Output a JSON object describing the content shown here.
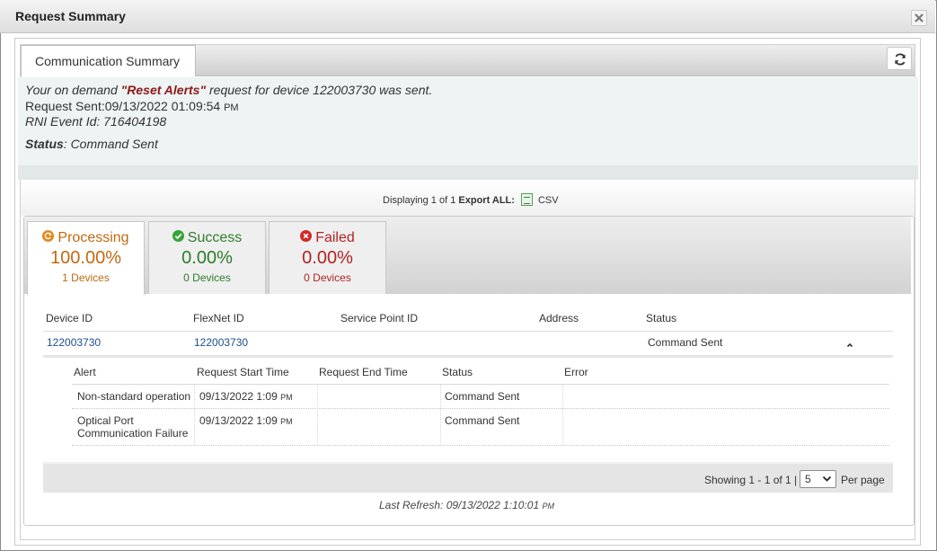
{
  "dialog": {
    "title": "Request Summary"
  },
  "tabs": {
    "main_label": "Communication Summary"
  },
  "info": {
    "line1_prefix": "Your on demand ",
    "alert_name": "\"Reset Alerts\"",
    "line1_suffix": " request for device 122003730 was sent.",
    "request_sent_prefix": "Request Sent:",
    "request_sent_value": "09/13/2022 01:09:54",
    "request_sent_ampm": "PM",
    "rni_event": "RNI Event Id: 716404198",
    "status_label": "Status",
    "status_value": ": Command Sent"
  },
  "export": {
    "displaying": "Displaying 1 of 1",
    "export_all": "Export ALL:",
    "csv": "CSV"
  },
  "stats": [
    {
      "label": "Processing",
      "pct": "100.00%",
      "devices": "1 Devices",
      "color": "#c06a10",
      "icon": "refresh-circle-icon"
    },
    {
      "label": "Success",
      "pct": "0.00%",
      "devices": "0 Devices",
      "color": "#2e7d2e",
      "icon": "check-circle-icon"
    },
    {
      "label": "Failed",
      "pct": "0.00%",
      "devices": "0 Devices",
      "color": "#b32323",
      "icon": "x-circle-icon"
    }
  ],
  "devices_table": {
    "headers": [
      "Device ID",
      "FlexNet ID",
      "Service Point ID",
      "Address",
      "Status"
    ],
    "rows": [
      {
        "device_id": "122003730",
        "flexnet_id": "122003730",
        "service_point_id": "",
        "address": "",
        "status": "Command Sent"
      }
    ]
  },
  "alerts_table": {
    "headers": [
      "Alert",
      "Request Start Time",
      "Request End Time",
      "Status",
      "Error"
    ],
    "rows": [
      {
        "alert": "Non-standard operation",
        "start": "09/13/2022 1:09",
        "start_ampm": "PM",
        "end": "",
        "status": "Command Sent",
        "error": ""
      },
      {
        "alert_line1": "Optical Port",
        "alert_line2": "Communication Failure",
        "start": "09/13/2022 1:09",
        "start_ampm": "PM",
        "end": "",
        "status": "Command Sent",
        "error": ""
      }
    ]
  },
  "pager": {
    "showing": "Showing 1 - 1 of 1 |",
    "page_size": "5",
    "per_page": "Per page"
  },
  "last_refresh": {
    "text": "Last Refresh: 09/13/2022 1:10:01",
    "ampm": "PM"
  }
}
